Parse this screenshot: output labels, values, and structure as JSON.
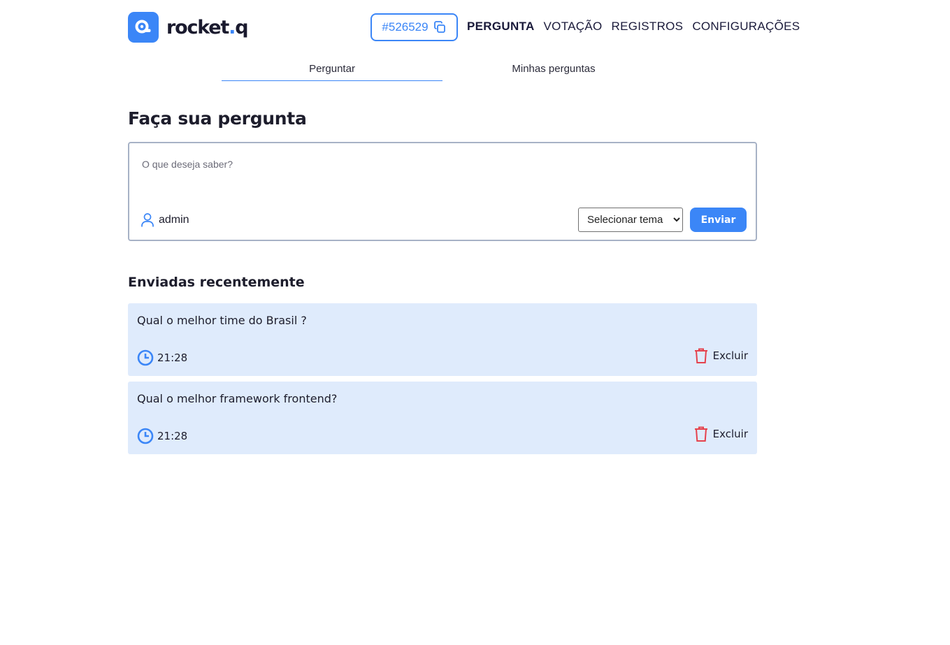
{
  "brand": {
    "name_main": "rocket",
    "name_dot": ".",
    "name_suffix": "q",
    "accent": "#3b86f7"
  },
  "room": {
    "code": "#526529",
    "copy_icon": "copy-icon"
  },
  "nav": {
    "items": [
      {
        "label": "PERGUNTA",
        "active": true
      },
      {
        "label": "VOTAÇÃO",
        "active": false
      },
      {
        "label": "REGISTROS",
        "active": false
      },
      {
        "label": "CONFIGURAÇÕES",
        "active": false
      }
    ]
  },
  "tabs": [
    {
      "label": "Perguntar",
      "active": true
    },
    {
      "label": "Minhas perguntas",
      "active": false
    }
  ],
  "ask": {
    "title": "Faça sua pergunta",
    "placeholder": "O que deseja saber?",
    "value": "",
    "user": "admin",
    "theme_select": "Selecionar tema",
    "send_label": "Enviar"
  },
  "recent": {
    "title": "Enviadas recentemente",
    "questions": [
      {
        "text": "Qual o melhor time do Brasil ?",
        "time": "21:28",
        "delete_label": "Excluir"
      },
      {
        "text": "Qual o melhor framework frontend?",
        "time": "21:28",
        "delete_label": "Excluir"
      }
    ]
  },
  "colors": {
    "card_bg": "#dfebfc",
    "delete_red": "#e5424d",
    "border": "#a7b2c6"
  }
}
